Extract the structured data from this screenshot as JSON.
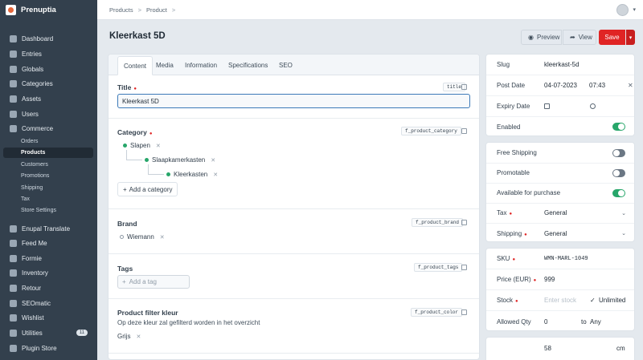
{
  "app": {
    "name": "Prenuptia"
  },
  "nav": {
    "items": [
      {
        "label": "Dashboard",
        "icon": "dashboard-icon"
      },
      {
        "label": "Entries",
        "icon": "entries-icon"
      },
      {
        "label": "Globals",
        "icon": "globals-icon"
      },
      {
        "label": "Categories",
        "icon": "categories-icon"
      },
      {
        "label": "Assets",
        "icon": "assets-icon"
      },
      {
        "label": "Users",
        "icon": "users-icon"
      },
      {
        "label": "Commerce",
        "icon": "commerce-icon"
      }
    ],
    "commerce_sub": [
      "Orders",
      "Products",
      "Customers",
      "Promotions",
      "Shipping",
      "Tax",
      "Store Settings"
    ],
    "plugins": [
      {
        "label": "Enupal Translate",
        "icon": "translate-icon"
      },
      {
        "label": "Feed Me",
        "icon": "feed-icon"
      },
      {
        "label": "Formie",
        "icon": "formie-icon"
      },
      {
        "label": "Inventory",
        "icon": "inventory-icon"
      },
      {
        "label": "Retour",
        "icon": "retour-icon"
      },
      {
        "label": "SEOmatic",
        "icon": "seomatic-icon"
      },
      {
        "label": "Wishlist",
        "icon": "wishlist-icon"
      },
      {
        "label": "Utilities",
        "icon": "utilities-icon",
        "badge": "11"
      },
      {
        "label": "Plugin Store",
        "icon": "plugin-store-icon"
      }
    ]
  },
  "breadcrumb": [
    "Products",
    "Product"
  ],
  "page": {
    "title": "Kleerkast 5D"
  },
  "actions": {
    "preview": "Preview",
    "view": "View",
    "save": "Save"
  },
  "tabs": [
    "Content",
    "Media",
    "Information",
    "Specifications",
    "SEO"
  ],
  "fields": {
    "title": {
      "label": "Title",
      "handle": "title",
      "value": "Kleerkast 5D"
    },
    "category": {
      "label": "Category",
      "handle": "f_product_category",
      "items": [
        "Slapen",
        "Slaapkamerkasten",
        "Kleerkasten"
      ],
      "add": "Add a category"
    },
    "brand": {
      "label": "Brand",
      "handle": "f_product_brand",
      "value": "Wiemann"
    },
    "tags": {
      "label": "Tags",
      "handle": "f_product_tags",
      "placeholder": "Add a tag"
    },
    "color": {
      "label": "Product filter kleur",
      "handle": "f_product_color",
      "instructions": "Op deze kleur zal gefilterd worden in het overzicht",
      "value": "Grijs"
    }
  },
  "meta": {
    "slug": {
      "label": "Slug",
      "value": "kleerkast-5d"
    },
    "post_date": {
      "label": "Post Date",
      "date": "04-07-2023",
      "time": "07:43"
    },
    "expiry_date": {
      "label": "Expiry Date"
    },
    "enabled": {
      "label": "Enabled",
      "on": true
    },
    "free_shipping": {
      "label": "Free Shipping",
      "on": false
    },
    "promotable": {
      "label": "Promotable",
      "on": false
    },
    "available": {
      "label": "Available for purchase",
      "on": true
    },
    "tax": {
      "label": "Tax",
      "value": "General"
    },
    "shipping": {
      "label": "Shipping",
      "value": "General"
    },
    "sku": {
      "label": "SKU",
      "value": "WMN-MARL-1049"
    },
    "price": {
      "label": "Price (EUR)",
      "value": "999"
    },
    "stock": {
      "label": "Stock",
      "placeholder": "Enter stock",
      "unlimited": "Unlimited"
    },
    "allowed_qty": {
      "label": "Allowed Qty",
      "min": "0",
      "to": "to",
      "max": "Any"
    },
    "dimension": {
      "value": "58",
      "unit": "cm"
    }
  },
  "colors": {
    "sidebar": "#33404d",
    "save": "#e02424",
    "toggle_on": "#27a66a",
    "focus": "#3c7ab8"
  }
}
